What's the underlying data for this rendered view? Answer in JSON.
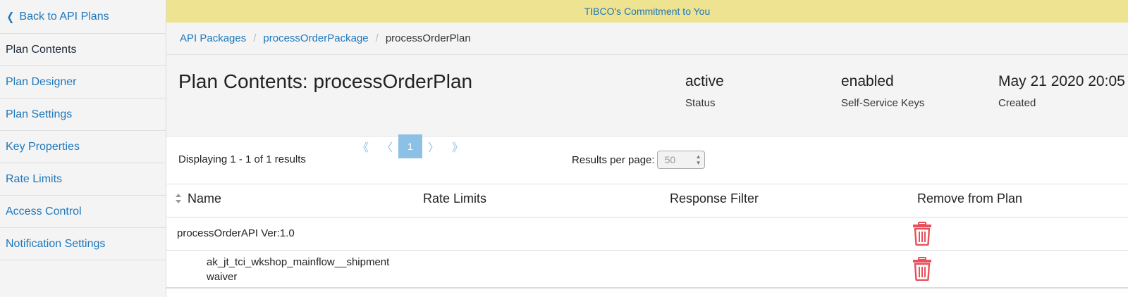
{
  "sidebar": {
    "back_label": "Back to API Plans",
    "items": [
      {
        "label": "Plan Contents"
      },
      {
        "label": "Plan Designer"
      },
      {
        "label": "Plan Settings"
      },
      {
        "label": "Key Properties"
      },
      {
        "label": "Rate Limits"
      },
      {
        "label": "Access Control"
      },
      {
        "label": "Notification Settings"
      }
    ],
    "active_item": "Plan Contents"
  },
  "banner": {
    "text": "TIBCO's Commitment to You"
  },
  "breadcrumb": [
    "API Packages",
    "processOrderPackage",
    "processOrderPlan"
  ],
  "header": {
    "title": "Plan Contents: processOrderPlan",
    "stats": [
      {
        "value": "active",
        "label": "Status"
      },
      {
        "value": "enabled",
        "label": "Self-Service Keys"
      },
      {
        "value": "May 21 2020 20:05",
        "label": "Created"
      }
    ]
  },
  "pager": {
    "displaying": "Displaying 1 - 1 of 1 results",
    "first": "《",
    "prev": "〈",
    "current_page": "1",
    "next": "〉",
    "last": "》",
    "results_per_page_label": "Results per page:",
    "results_per_page_value": "50"
  },
  "table": {
    "columns": [
      "Name",
      "Rate Limits",
      "Response Filter",
      "Remove from Plan"
    ],
    "rows": [
      {
        "name": "processOrderAPI Ver:1.0"
      },
      {
        "name": "ak_jt_tci_wkshop_mainflow__shipmentwaiver"
      }
    ]
  },
  "colors": {
    "link": "#1f77bb",
    "banner_bg": "#ede390",
    "trash": "#e8505b",
    "pager": "#8cc0e4"
  },
  "icons": {
    "back": "chevron-left-icon",
    "sort": "sort-icon",
    "remove": "trash-icon"
  }
}
